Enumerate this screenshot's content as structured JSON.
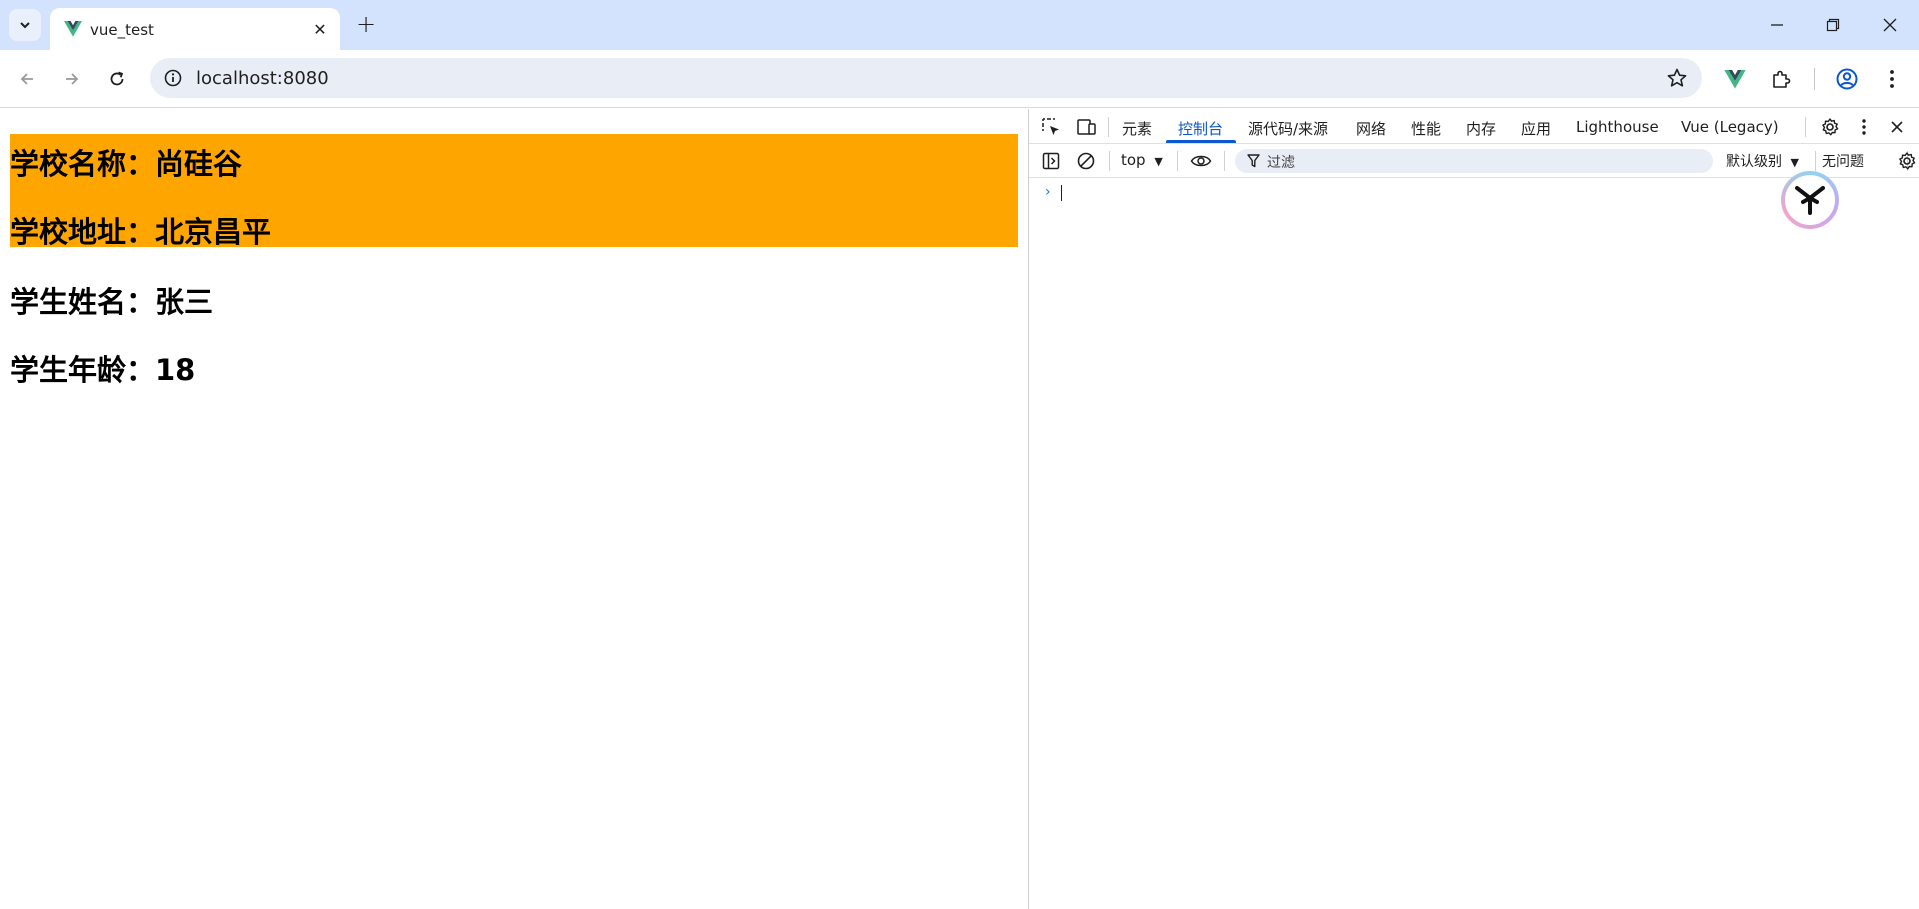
{
  "browser": {
    "tab_title": "vue_test",
    "url": "localhost:8080",
    "new_tab_glyph": "+",
    "close_glyph": "✕"
  },
  "page": {
    "school_name": "学校名称：尚硅谷",
    "school_address": "学校地址：北京昌平",
    "student_name": "学生姓名：张三",
    "student_age": "学生年龄：18",
    "highlight_color": "#ffa500"
  },
  "devtools": {
    "tabs": [
      {
        "label": "元素"
      },
      {
        "label": "控制台"
      },
      {
        "label": "源代码/来源"
      },
      {
        "label": "网络"
      },
      {
        "label": "性能"
      },
      {
        "label": "内存"
      },
      {
        "label": "应用"
      },
      {
        "label": "Lighthouse"
      },
      {
        "label": "Vue (Legacy)"
      }
    ],
    "active_tab": "控制台",
    "context": "top",
    "filter_placeholder": "过滤",
    "levels": "默认级别",
    "issues": "无问题",
    "prompt_glyph": "›"
  },
  "icons": {
    "tab_search": "chevron-down-icon",
    "favicon": "vue-logo-icon",
    "back": "arrow-left-icon",
    "forward": "arrow-right-icon",
    "reload": "reload-icon",
    "site_info": "info-icon",
    "bookmark": "star-icon",
    "vue_ext": "vue-extension-icon",
    "extensions": "puzzle-icon",
    "profile": "profile-icon",
    "menu": "kebab-menu-icon"
  }
}
